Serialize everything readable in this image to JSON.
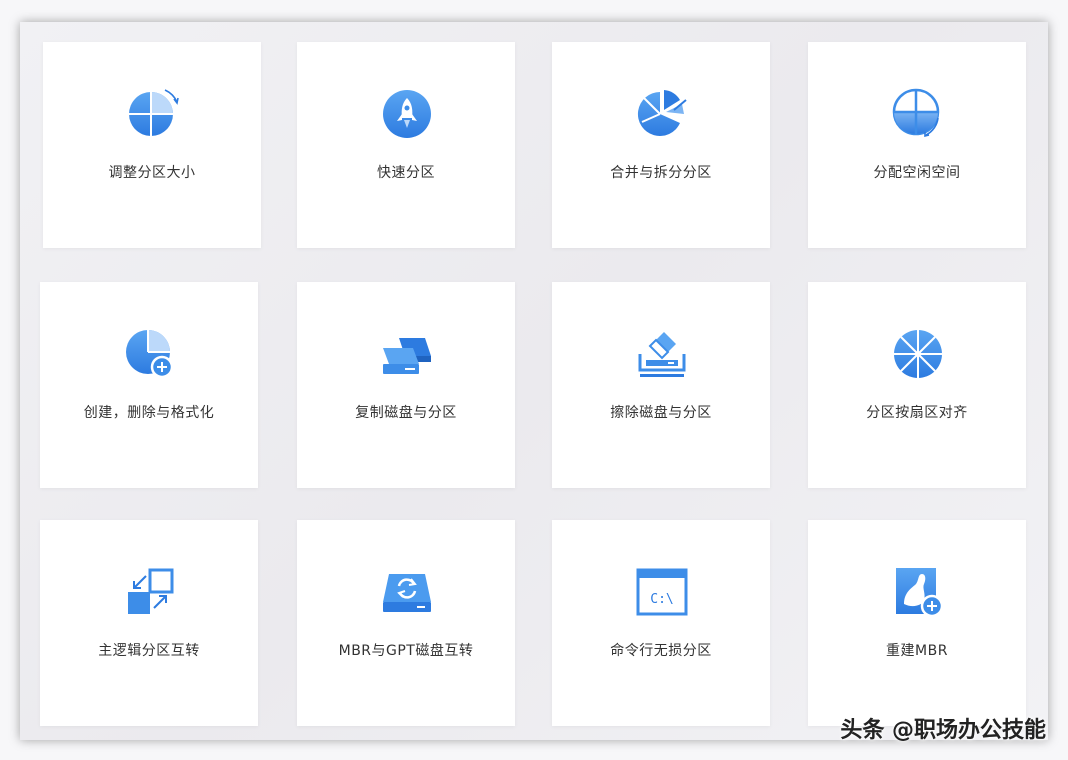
{
  "features": [
    {
      "label": "调整分区大小",
      "icon": "pie-resize-icon"
    },
    {
      "label": "快速分区",
      "icon": "rocket-icon"
    },
    {
      "label": "合并与拆分分区",
      "icon": "pie-split-icon"
    },
    {
      "label": "分配空闲空间",
      "icon": "pie-allocate-icon"
    },
    {
      "label": "创建，删除与格式化",
      "icon": "pie-add-icon"
    },
    {
      "label": "复制磁盘与分区",
      "icon": "disk-copy-icon"
    },
    {
      "label": "擦除磁盘与分区",
      "icon": "disk-erase-icon"
    },
    {
      "label": "分区按扇区对齐",
      "icon": "sector-align-icon"
    },
    {
      "label": "主逻辑分区互转",
      "icon": "convert-squares-icon"
    },
    {
      "label": "MBR与GPT磁盘互转",
      "icon": "disk-convert-icon"
    },
    {
      "label": "命令行无损分区",
      "icon": "command-line-icon"
    },
    {
      "label": "重建MBR",
      "icon": "rebuild-mbr-icon"
    }
  ],
  "watermark": "头条 @职场办公技能",
  "colors": {
    "accent": "#3d8de8",
    "accent_light": "#7bb4f3",
    "accent_dark": "#2a6fcf"
  }
}
